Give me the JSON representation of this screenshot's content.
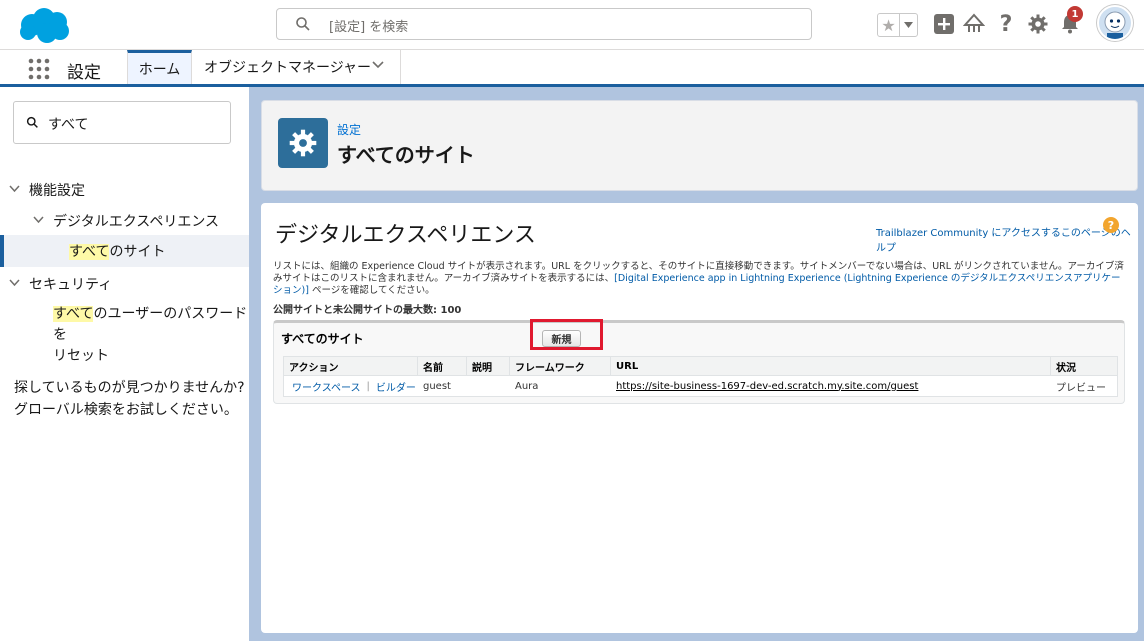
{
  "header": {
    "search_placeholder": "[設定] を検索",
    "notification_count": "1",
    "icons": [
      "star-icon",
      "chevron-down-icon",
      "add-icon",
      "trailhead-icon",
      "help-icon",
      "gear-icon",
      "bell-icon",
      "avatar"
    ]
  },
  "nav": {
    "app_name": "設定",
    "tabs": [
      {
        "label": "ホーム"
      },
      {
        "label": "オブジェクトマネージャー"
      }
    ]
  },
  "sidebar": {
    "search_value": "すべて",
    "tree": {
      "features_label": "機能設定",
      "digital_label": "デジタルエクスペリエンス",
      "selected_hl": "すべて",
      "selected_rest": "のサイト",
      "security_label": "セキュリティ",
      "reset_hl": "すべて",
      "reset_rest_1": "のユーザーのパスワードを",
      "reset_rest_2": "リセット"
    },
    "not_found_1": "探しているものが見つかりませんか?",
    "not_found_2": "グローバル検索をお試しください。"
  },
  "page_header": {
    "subtitle": "設定",
    "title": "すべてのサイト"
  },
  "content": {
    "title": "デジタルエクスペリエンス",
    "help_link": "Trailblazer Community にアクセスするこのページのヘルプ",
    "help_icon": "?",
    "desc_1": "リストには、組織の Experience Cloud サイトが表示されます。URL をクリックすると、そのサイトに直接移動できます。サイトメンバーでない場合は、URL がリンクされていません。アーカイブ済みサイトはこのリストに含まれません。アーカイブ済みサイトを表示するには、",
    "desc_link": "[Digital Experience app in Lightning Experience (Lightning Experience のデジタルエクスペリエンスアプリケーション)]",
    "desc_2": " ページを確認してください。",
    "max_sites": "公開サイトと未公開サイトの最大数: 100",
    "block_title": "すべてのサイト",
    "new_button": "新規",
    "table": {
      "headers": [
        "アクション",
        "名前",
        "説明",
        "フレームワーク",
        "URL",
        "状況"
      ],
      "row": {
        "action_workspace": "ワークスペース",
        "action_sep": "|",
        "action_builder": "ビルダー",
        "name": "guest",
        "description": "",
        "framework": "Aura",
        "url": "https://site-business-1697-dev-ed.scratch.my.site.com/guest",
        "status": "プレビュー"
      }
    }
  },
  "colors": {
    "brand_blue": "#1b5f9e",
    "link_blue": "#015ba7",
    "highlight": "#fef9a7",
    "red_box": "#e0192f",
    "main_bg": "#b0c4df"
  }
}
